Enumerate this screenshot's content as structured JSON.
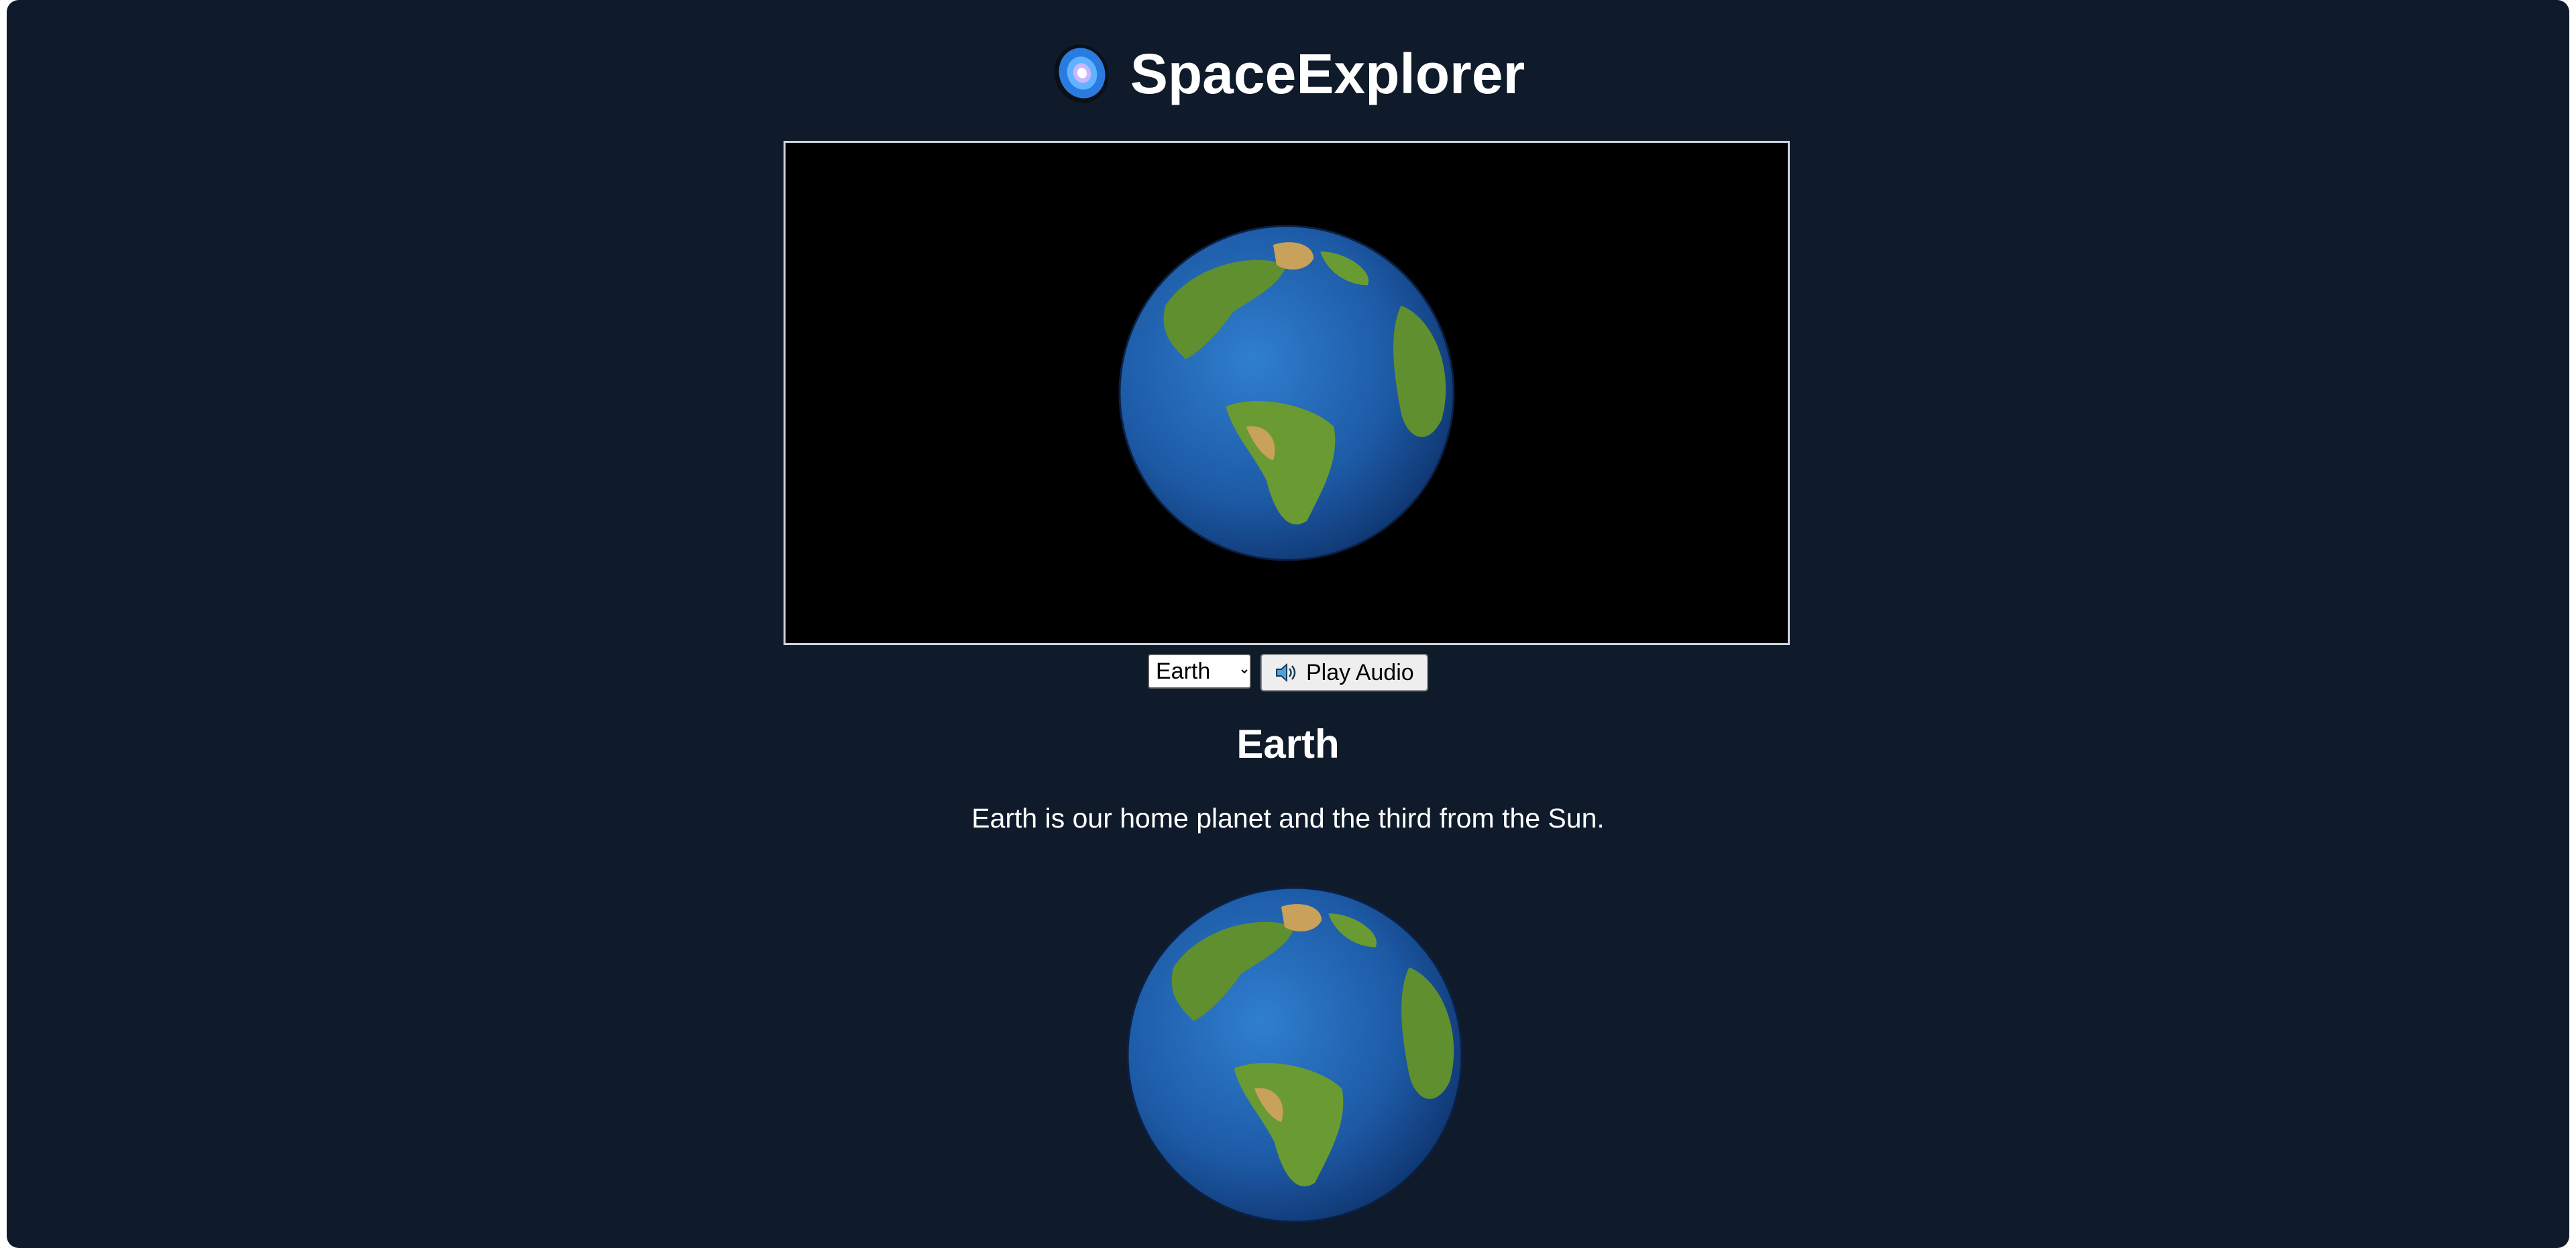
{
  "app": {
    "title": "SpaceExplorer",
    "logo_icon": "galaxy-icon",
    "background_color": "#0f1b2b"
  },
  "viewer": {
    "planet": "Earth",
    "background_color": "#000000"
  },
  "controls": {
    "planet_select": {
      "selected": "Earth"
    },
    "play_audio": {
      "label": "Play Audio",
      "icon": "speaker-icon"
    }
  },
  "planet_info": {
    "name": "Earth",
    "description": "Earth is our home planet and the third from the Sun."
  },
  "colors": {
    "ocean": "#1f5fa8",
    "land": "#5f8f2f",
    "desert": "#c8a25a"
  }
}
